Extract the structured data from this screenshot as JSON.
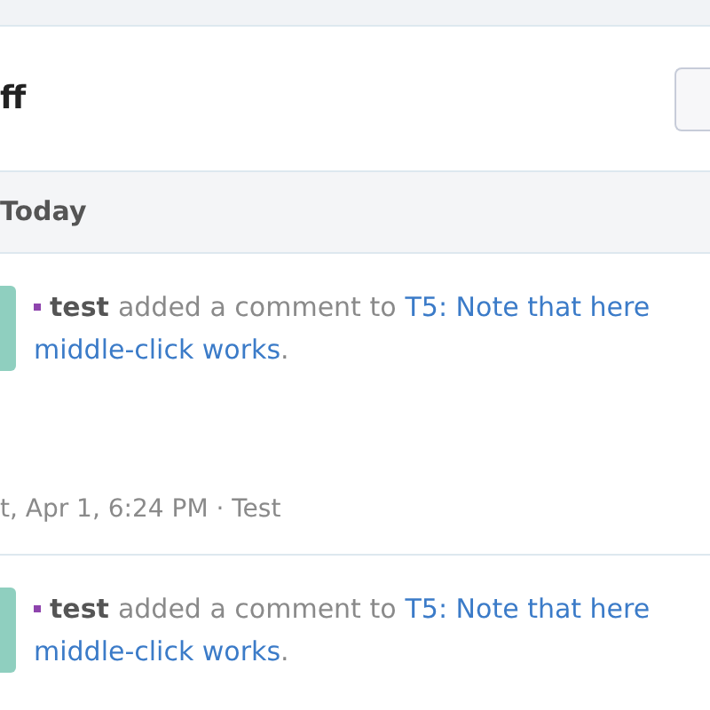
{
  "header": {
    "title": "ff"
  },
  "group": {
    "label": "Today"
  },
  "stories": [
    {
      "actor": "test",
      "action": "added a comment to",
      "link_lines": [
        "T5: Note that here",
        "middle-click works"
      ],
      "end": ".",
      "meta": "t, Apr 1, 6:24 PM · Test"
    },
    {
      "actor": "test",
      "action": "added a comment to",
      "link_lines": [
        "T5: Note that here",
        "middle-click works"
      ],
      "end": "."
    }
  ]
}
